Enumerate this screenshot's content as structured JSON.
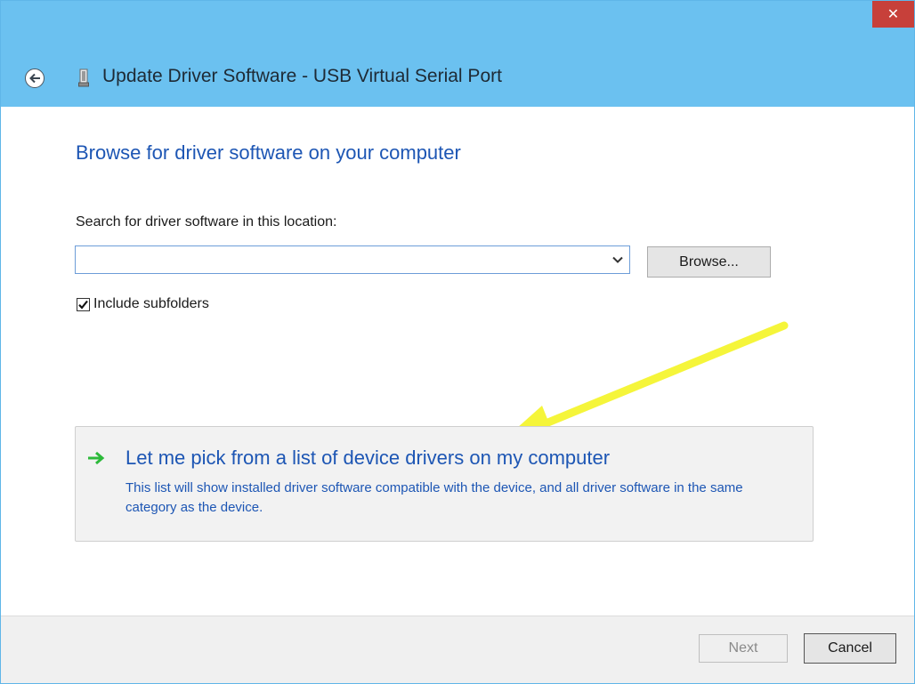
{
  "window": {
    "title": "Update Driver Software - USB Virtual Serial Port",
    "close_glyph": "✕",
    "icons": {
      "close": "close-icon",
      "back": "back-arrow-icon",
      "device": "usb-device-icon"
    }
  },
  "page": {
    "heading": "Browse for driver software on your computer"
  },
  "search": {
    "label": "Search for driver software in this location:",
    "path_value": "",
    "path_placeholder": "",
    "browse_label": "Browse..."
  },
  "subfolders": {
    "label": "Include subfolders",
    "checked": true
  },
  "pick_link": {
    "title": "Let me pick from a list of device drivers on my computer",
    "description": "This list will show installed driver software compatible with the device, and all driver software in the same category as the device.",
    "icon": "green-arrow-icon"
  },
  "footer": {
    "next_label": "Next",
    "next_enabled": false,
    "cancel_label": "Cancel"
  },
  "colors": {
    "header_bg": "#6bc1f0",
    "close_bg": "#c7403a",
    "link_blue": "#1d56b4",
    "annotation_yellow": "#f5f53a",
    "green_arrow": "#2dba3b"
  }
}
